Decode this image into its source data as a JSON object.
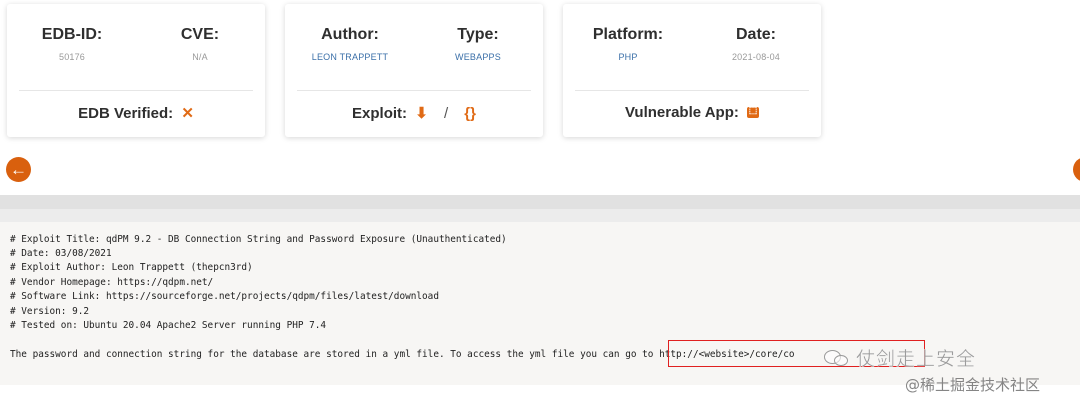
{
  "card1": {
    "edb_id_label": "EDB-ID:",
    "edb_id_value": "50176",
    "cve_label": "CVE:",
    "cve_value": "N/A",
    "verified_label": "EDB Verified:",
    "verified_icon": "✕"
  },
  "card2": {
    "author_label": "Author:",
    "author_value": "LEON TRAPPETT",
    "type_label": "Type:",
    "type_value": "WEBAPPS",
    "exploit_label": "Exploit:",
    "download_icon": "⬇",
    "separator": "/",
    "code_icon": "{}"
  },
  "card3": {
    "platform_label": "Platform:",
    "platform_value": "PHP",
    "date_label": "Date:",
    "date_value": "2021-08-04",
    "vuln_label": "Vulnerable App:",
    "vuln_icon": "⬚"
  },
  "nav": {
    "prev_icon": "←",
    "next_icon": "→"
  },
  "code": {
    "lines": [
      "# Exploit Title: qdPM 9.2 - DB Connection String and Password Exposure (Unauthenticated)",
      "# Date: 03/08/2021",
      "# Exploit Author: Leon Trappett (thepcn3rd)",
      "# Vendor Homepage: https://qdpm.net/",
      "# Software Link: https://sourceforge.net/projects/qdpm/files/latest/download",
      "# Version: 9.2",
      "# Tested on: Ubuntu 20.04 Apache2 Server running PHP 7.4",
      "",
      "The password and connection string for the database are stored in a yml file. To access the yml file you can go to http://<website>/core/co"
    ]
  },
  "watermark": {
    "line1": "仗剑走上安全",
    "line2": "@稀土掘金技术社区"
  },
  "colors": {
    "accent": "#e06a15",
    "link": "#3a6fa8",
    "highlight_box": "#e02020"
  }
}
